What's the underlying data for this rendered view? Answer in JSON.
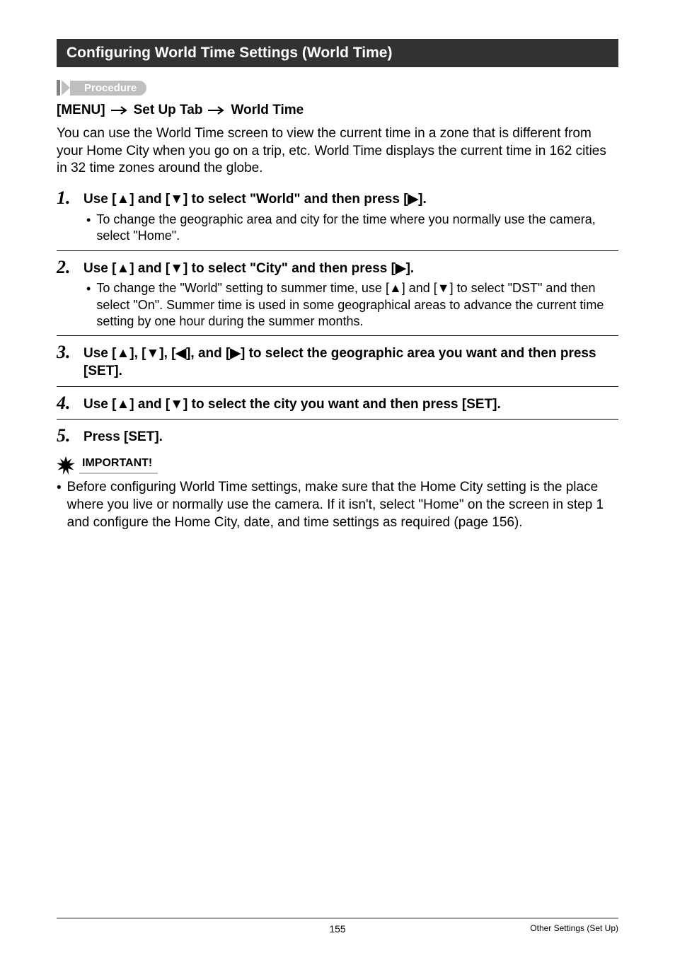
{
  "heading": "Configuring World Time Settings (World Time)",
  "procedure_label": "Procedure",
  "path": {
    "p1": "[MENU]",
    "arrow": "→",
    "p2": "Set Up Tab",
    "p3": "World Time"
  },
  "intro": "You can use the World Time screen to view the current time in a zone that is different from your Home City when you go on a trip, etc. World Time displays the current time in 162 cities in 32 time zones around the globe.",
  "steps": [
    {
      "num": "1.",
      "title": "Use [▲] and [▼] to select \"World\" and then press [▶].",
      "bullets": [
        "To change the geographic area and city for the time where you normally use the camera, select \"Home\"."
      ]
    },
    {
      "num": "2.",
      "title": "Use [▲] and [▼] to select \"City\" and then press [▶].",
      "bullets": [
        "To change the \"World\" setting to summer time, use [▲] and [▼] to select \"DST\" and then select \"On\". Summer time is used in some geographical areas to advance the current time setting by one hour during the summer months."
      ]
    },
    {
      "num": "3.",
      "title": "Use [▲], [▼], [◀], and [▶] to select the geographic area you want and then press [SET].",
      "bullets": []
    },
    {
      "num": "4.",
      "title": "Use [▲] and [▼] to select the city you want and then press [SET].",
      "bullets": []
    },
    {
      "num": "5.",
      "title": "Press [SET].",
      "bullets": []
    }
  ],
  "important_label": "IMPORTANT!",
  "important_bullet": "Before configuring World Time settings, make sure that the Home City setting is the place where you live or normally use the camera. If it isn't, select \"Home\" on the screen in step 1 and configure the Home City, date, and time settings as required (page 156).",
  "footer": {
    "page": "155",
    "section": "Other Settings (Set Up)"
  }
}
